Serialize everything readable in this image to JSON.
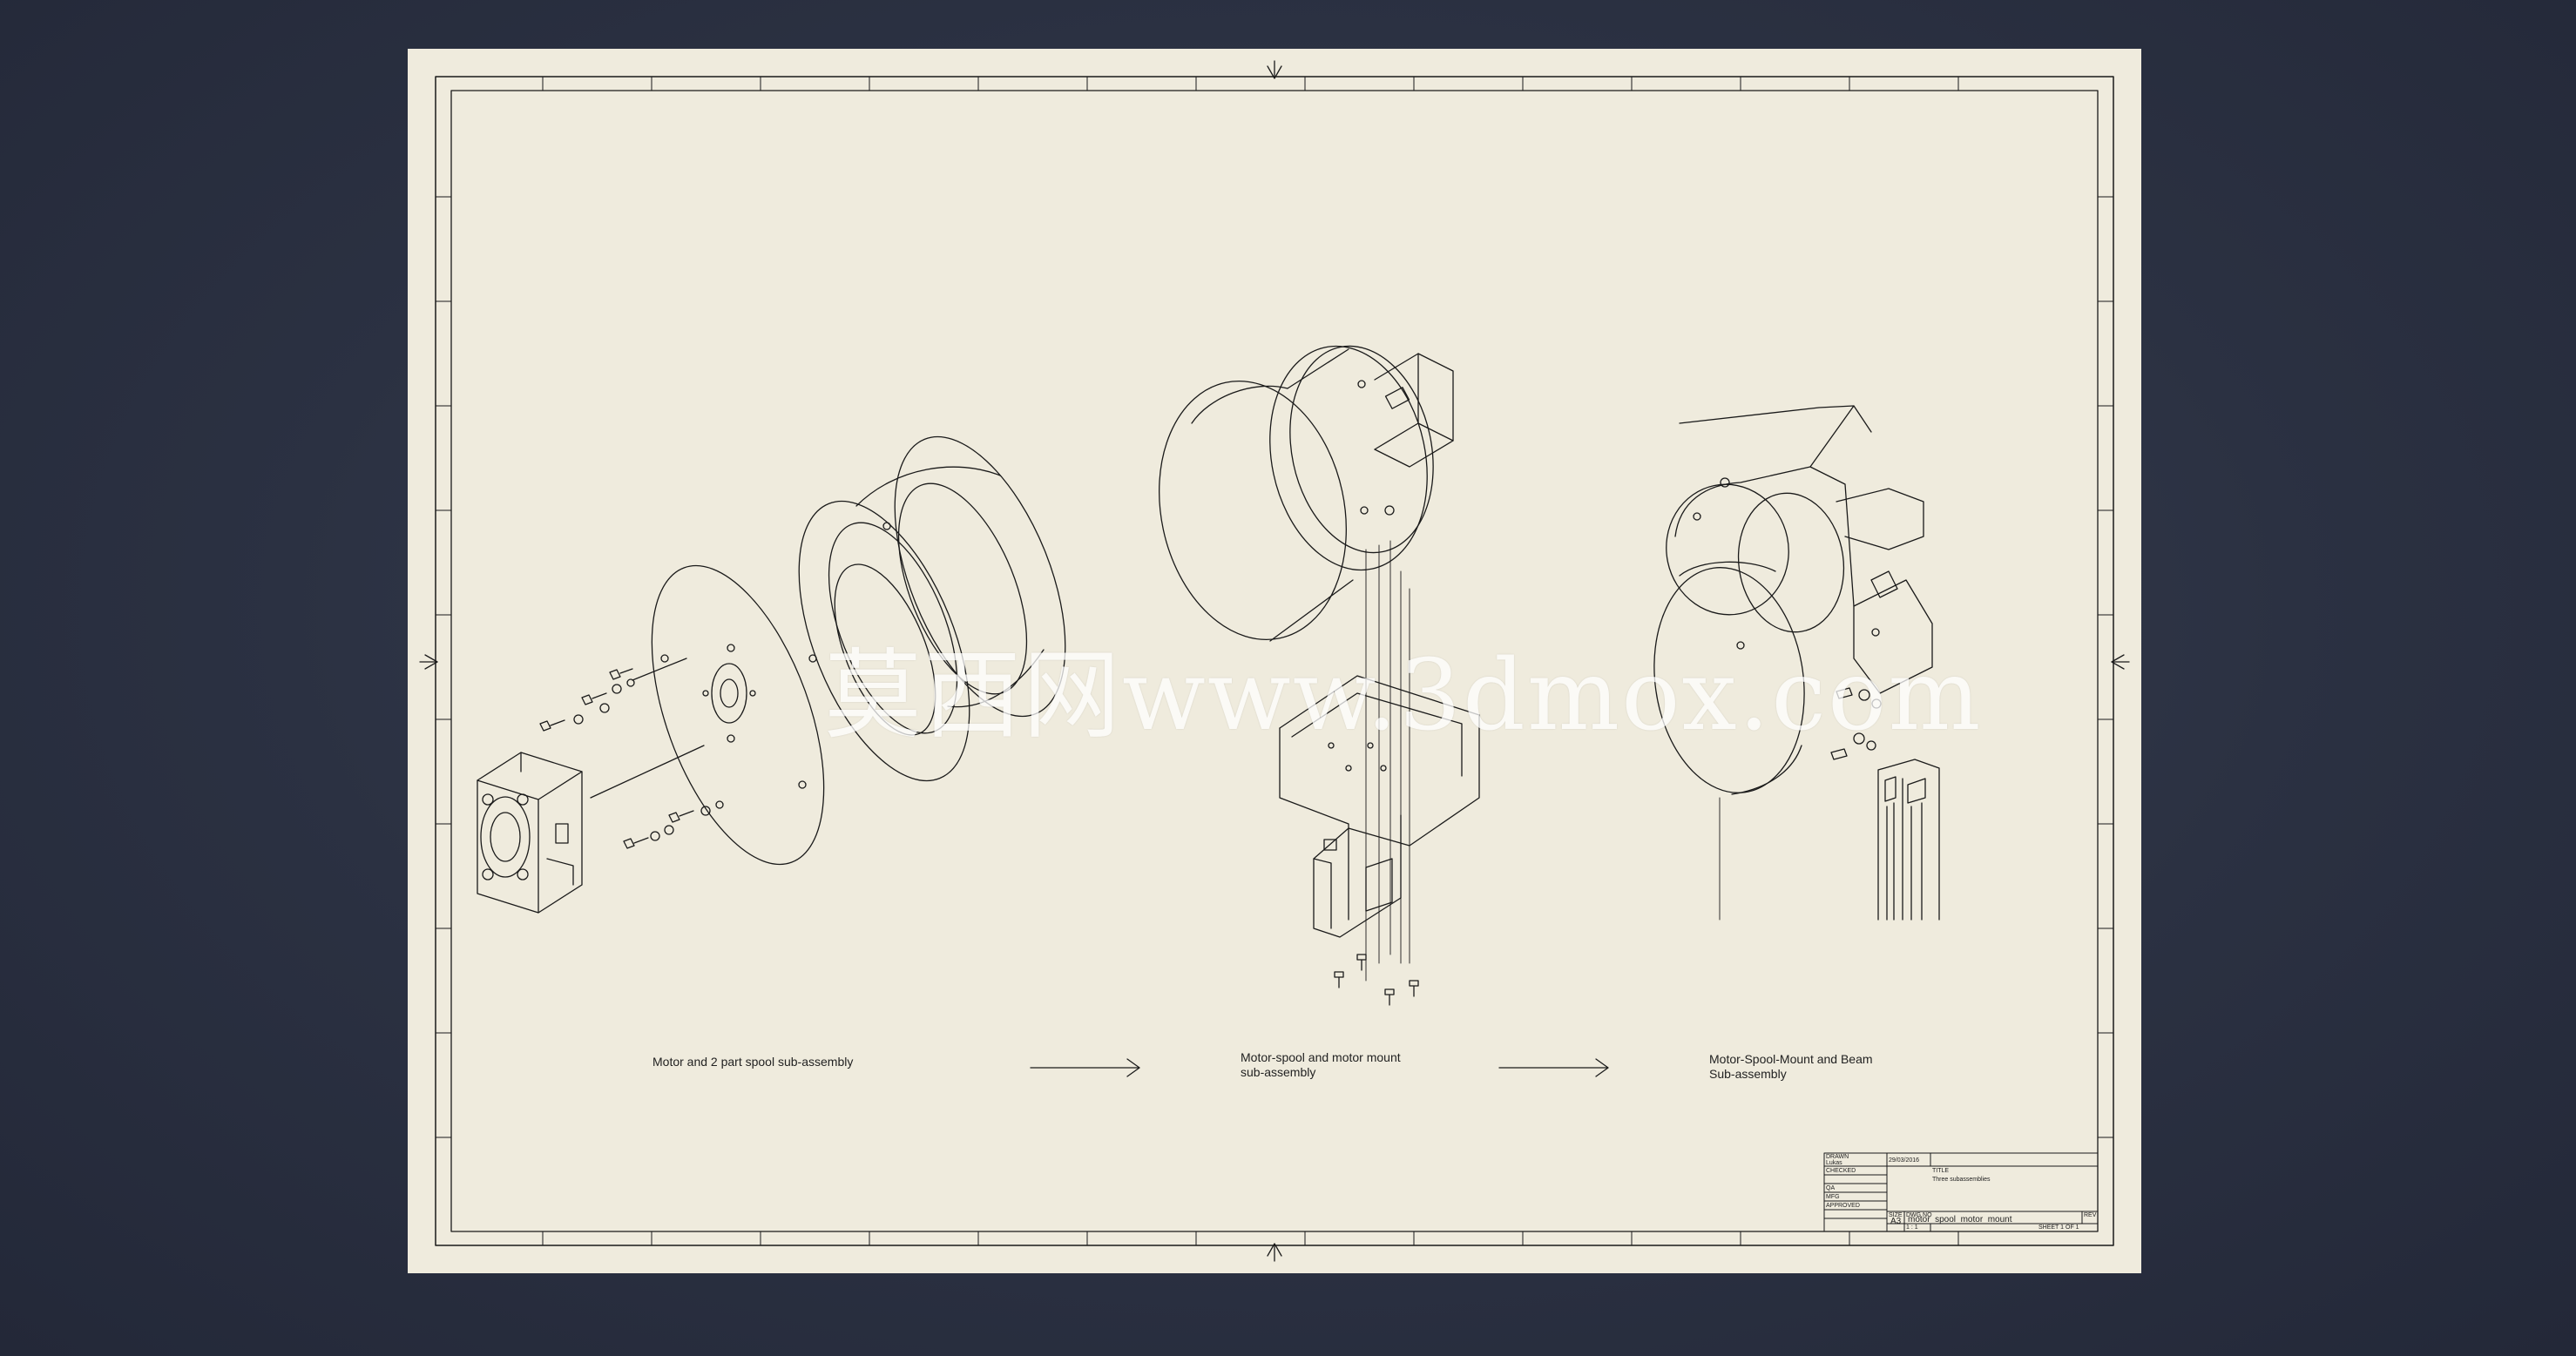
{
  "sheet": {
    "background": "#efebdd",
    "line_color": "#1a1a1a"
  },
  "captions": {
    "stage1": "Motor and 2 part spool sub-assembly",
    "stage2": "Motor-spool and motor mount\nsub-assembly",
    "stage3": "Motor-Spool-Mount and Beam\nSub-assembly"
  },
  "watermark": "莫西网www.3dmox.com",
  "title_block": {
    "drawn_label": "DRAWN",
    "drawn_by": "Lukas",
    "date": "29/03/2016",
    "checked_label": "CHECKED",
    "qa_label": "QA",
    "mfg_label": "MFG",
    "approved_label": "APPROVED",
    "title_label": "TITLE",
    "title": "Three subassemblies",
    "size_label": "SIZE",
    "size": "A3",
    "dwg_label": "DWG NO",
    "dwg_no": "motor_spool_motor_mount",
    "rev_label": "REV",
    "scale": "1 : 1",
    "sheet": "SHEET 1  OF 1"
  },
  "icons": [
    "center-mark-arrow-top",
    "center-mark-arrow-bottom",
    "center-mark-arrow-left",
    "center-mark-arrow-right",
    "flow-arrow"
  ]
}
